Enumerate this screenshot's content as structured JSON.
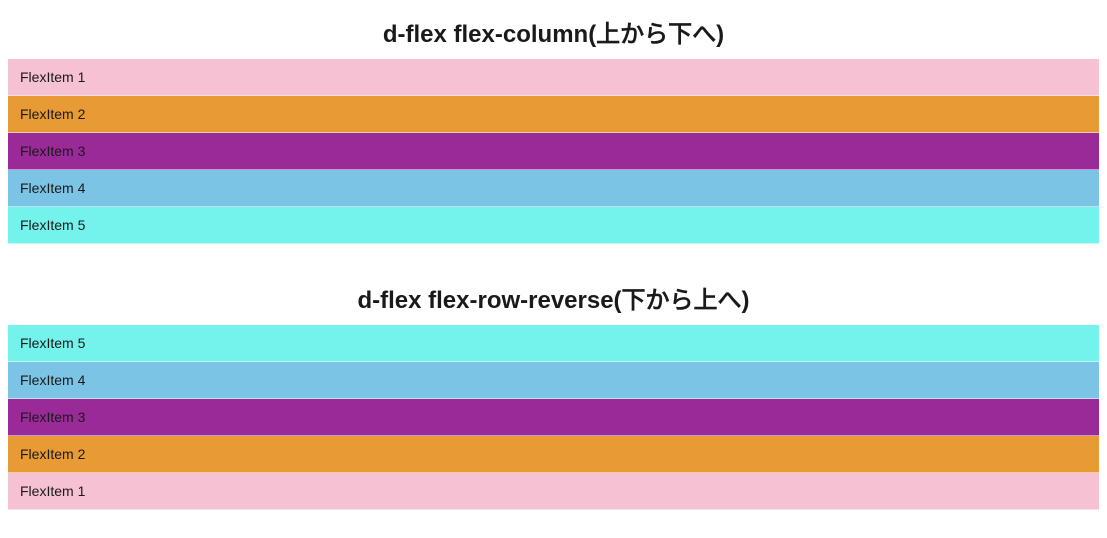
{
  "section1": {
    "heading": "d-flex flex-column(上から下へ)",
    "items": [
      {
        "label": "FlexItem 1",
        "bg": "pink"
      },
      {
        "label": "FlexItem 2",
        "bg": "orange"
      },
      {
        "label": "FlexItem 3",
        "bg": "purple"
      },
      {
        "label": "FlexItem 4",
        "bg": "skyblue"
      },
      {
        "label": "FlexItem 5",
        "bg": "cyan"
      }
    ]
  },
  "section2": {
    "heading": "d-flex flex-row-reverse(下から上へ)",
    "items": [
      {
        "label": "FlexItem 1",
        "bg": "pink"
      },
      {
        "label": "FlexItem 2",
        "bg": "orange"
      },
      {
        "label": "FlexItem 3",
        "bg": "purple"
      },
      {
        "label": "FlexItem 4",
        "bg": "skyblue"
      },
      {
        "label": "FlexItem 5",
        "bg": "cyan"
      }
    ]
  }
}
